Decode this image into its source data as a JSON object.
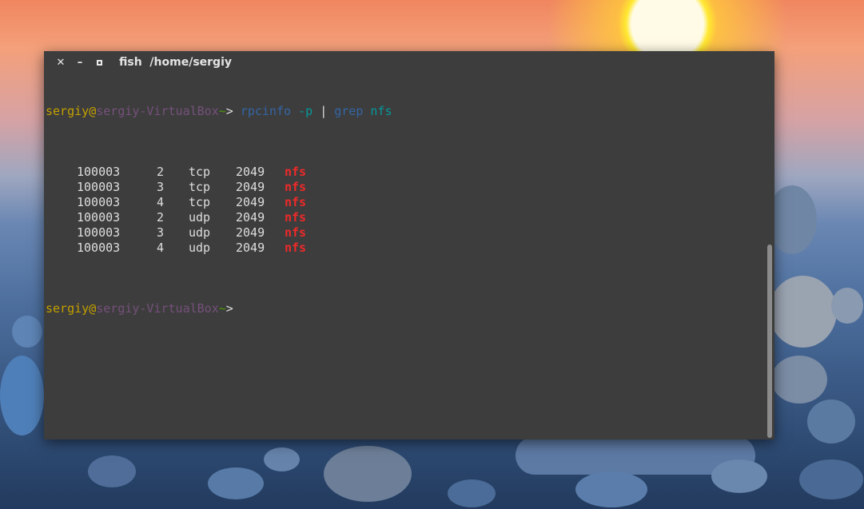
{
  "window": {
    "title": "fish  /home/sergiy",
    "close_glyph": "✕",
    "minimize_glyph": "–"
  },
  "prompt": {
    "user": "sergiy",
    "at": "@",
    "host": "sergiy-VirtualBox",
    "path": "~",
    "arrow": ">"
  },
  "command": {
    "program": "rpcinfo",
    "option": "-p",
    "pipe": "|",
    "filter": "grep",
    "pattern": "nfs"
  },
  "output_rows": [
    {
      "program": "100003",
      "vers": "2",
      "proto": "tcp",
      "port": "2049",
      "service": "nfs"
    },
    {
      "program": "100003",
      "vers": "3",
      "proto": "tcp",
      "port": "2049",
      "service": "nfs"
    },
    {
      "program": "100003",
      "vers": "4",
      "proto": "tcp",
      "port": "2049",
      "service": "nfs"
    },
    {
      "program": "100003",
      "vers": "2",
      "proto": "udp",
      "port": "2049",
      "service": "nfs"
    },
    {
      "program": "100003",
      "vers": "3",
      "proto": "udp",
      "port": "2049",
      "service": "nfs"
    },
    {
      "program": "100003",
      "vers": "4",
      "proto": "udp",
      "port": "2049",
      "service": "nfs"
    }
  ],
  "colors": {
    "terminal_bg": "#3d3d3d",
    "user": "#c4a000",
    "host": "#75507b",
    "command": "#3465a4",
    "highlight": "#ef2929"
  }
}
